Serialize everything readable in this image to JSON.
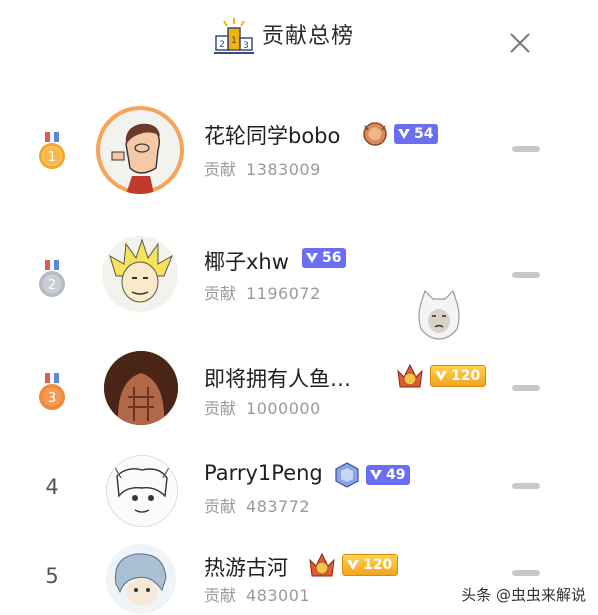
{
  "header": {
    "title": "贡献总榜",
    "icon": "podium-icon",
    "close_icon": "close-icon"
  },
  "rows": [
    {
      "rank": "1",
      "name": "花轮同学bobo",
      "contrib_label": "贡献",
      "contrib_value": "1383009",
      "level": "54",
      "level_style": "purple",
      "has_crown": true
    },
    {
      "rank": "2",
      "name": "椰子xhw",
      "contrib_label": "贡献",
      "contrib_value": "1196072",
      "level": "56",
      "level_style": "purple",
      "has_crown": false
    },
    {
      "rank": "3",
      "name": "即将拥有人鱼…",
      "contrib_label": "贡献",
      "contrib_value": "1000000",
      "level": "120",
      "level_style": "gold",
      "has_crown": true
    },
    {
      "rank": "4",
      "name": "Parry1Peng",
      "contrib_label": "贡献",
      "contrib_value": "483772",
      "level": "49",
      "level_style": "purple",
      "has_crown": true
    },
    {
      "rank": "5",
      "name": "热游古河",
      "contrib_label": "贡献",
      "contrib_value": "483001",
      "level": "120",
      "level_style": "gold",
      "has_crown": true
    }
  ],
  "watermark": "头条 @虫虫来解说",
  "colors": {
    "purple_badge": "#6a6ef0",
    "gold_badge": "#f0a520",
    "medal_gold": "#f5a623",
    "medal_silver": "#b7bcc4",
    "medal_bronze": "#f08a3a"
  }
}
